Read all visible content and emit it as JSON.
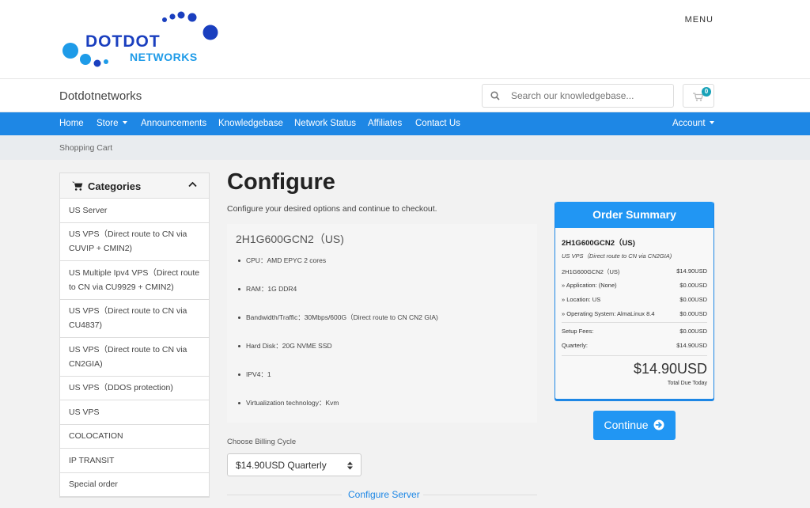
{
  "header": {
    "logo": {
      "line1": "DOTDOT",
      "line2": "NETWORKS"
    },
    "menu_label": "MENU"
  },
  "brandbar": {
    "brand_name": "Dotdotnetworks",
    "search_placeholder": "Search our knowledgebase...",
    "cart_count": "0"
  },
  "nav": {
    "items": [
      "Home",
      "Store",
      "Announcements",
      "Knowledgebase",
      "Network Status",
      "Affiliates",
      "Contact Us"
    ],
    "account": "Account"
  },
  "breadcrumb": "Shopping Cart",
  "sidebar": {
    "title": "Categories",
    "categories": [
      "US Server",
      "US VPS（Direct route to CN via CUVIP + CMIN2)",
      "US Multiple Ipv4 VPS（Direct route to CN via CU9929 + CMIN2)",
      "US VPS（Direct route to CN via CU4837)",
      "US VPS（Direct route to CN via CN2GIA)",
      "US VPS（DDOS protection)",
      "US VPS",
      "COLOCATION",
      "IP TRANSIT",
      "Special order"
    ]
  },
  "main": {
    "title": "Configure",
    "subtitle": "Configure your desired options and continue to checkout.",
    "product_name": "2H1G600GCN2（US)",
    "features": [
      "CPU：AMD EPYC 2 cores",
      "RAM：1G DDR4",
      "Bandwidth/Traffic：30Mbps/600G（Direct route to CN CN2 GIA)",
      "Hard Disk：20G NVME SSD",
      "IPV4：1",
      "Virtualization technology：Kvm"
    ],
    "billing_label": "Choose Billing Cycle",
    "billing_value": "$14.90USD Quarterly",
    "section_title": "Configure Server"
  },
  "summary": {
    "title": "Order Summary",
    "product_name": "2H1G600GCN2（US)",
    "product_group": "US VPS（Direct route to CN via CN2GIA)",
    "line_item": {
      "label": "2H1G600GCN2（US)",
      "value": "$14.90USD"
    },
    "options": [
      {
        "label": "» Application: (None)",
        "value": "$0.00USD"
      },
      {
        "label": "» Location: US",
        "value": "$0.00USD"
      },
      {
        "label": "» Operating System: AlmaLinux 8.4",
        "value": "$0.00USD"
      }
    ],
    "setup_fees": {
      "label": "Setup Fees:",
      "value": "$0.00USD"
    },
    "recurring": {
      "label": "Quarterly:",
      "value": "$14.90USD"
    },
    "total": "$14.90USD",
    "total_label": "Total Due Today",
    "continue_label": "Continue"
  },
  "colors": {
    "primary": "#1e87e5",
    "summary_head": "#2196f3",
    "badge": "#17a2b8",
    "logo_blue": "#1a3fbf",
    "logo_cyan": "#1e9be8"
  }
}
